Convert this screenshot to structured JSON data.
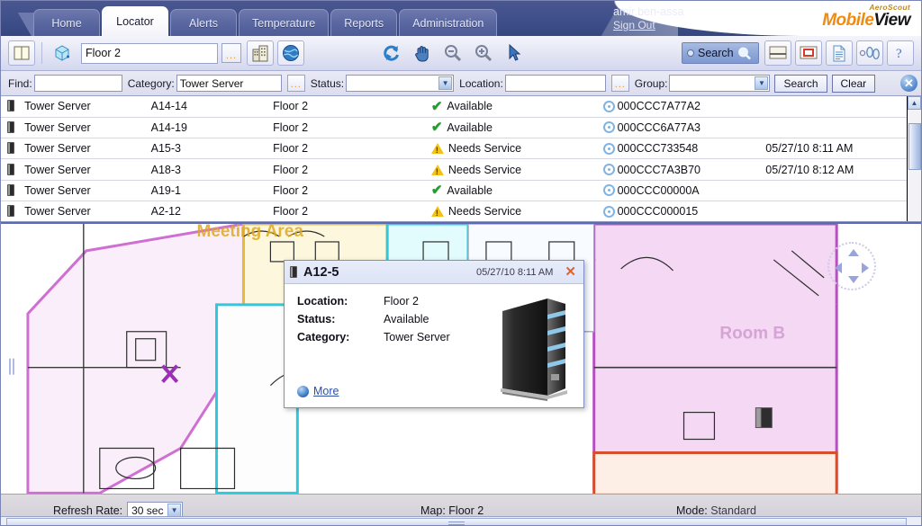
{
  "app": {
    "brand_top": "AeroScout",
    "brand_main_a": "Mobile",
    "brand_main_b": "View"
  },
  "header": {
    "tabs": [
      {
        "label": "Home",
        "active": false
      },
      {
        "label": "Locator",
        "active": true
      },
      {
        "label": "Alerts",
        "active": false
      },
      {
        "label": "Temperature",
        "active": false
      },
      {
        "label": "Reports",
        "active": false
      },
      {
        "label": "Administration",
        "active": false
      }
    ],
    "user": "amir.ben-assa",
    "sign_out": "Sign Out"
  },
  "toolbar": {
    "map_value": "Floor 2",
    "browse_dots": "...",
    "search_label": "Search",
    "icons": [
      "panel-toggle-icon",
      "add-zone-icon",
      "building-icon",
      "globe-icon",
      "refresh-icon",
      "pan-hand-icon",
      "zoom-out-icon",
      "zoom-in-icon",
      "select-arrow-icon",
      "split-view-icon",
      "highlight-box-icon",
      "report-page-icon",
      "footprints-icon",
      "help-icon"
    ]
  },
  "filterbar": {
    "find_label": "Find:",
    "find_value": "",
    "category_label": "Category:",
    "category_value": "Tower Server",
    "category_dots": "...",
    "status_label": "Status:",
    "status_value": "",
    "location_label": "Location:",
    "location_value": "",
    "location_dots": "...",
    "group_label": "Group:",
    "group_value": "",
    "search_button": "Search",
    "clear_button": "Clear"
  },
  "table": {
    "rows": [
      {
        "icon": "server-icon",
        "category": "Tower Server",
        "name": "A14-14",
        "location": "Floor 2",
        "status": "Available",
        "status_type": "ok",
        "tag": "000CCC7A77A2",
        "time": ""
      },
      {
        "icon": "server-icon",
        "category": "Tower Server",
        "name": "A14-19",
        "location": "Floor 2",
        "status": "Available",
        "status_type": "ok",
        "tag": "000CCC6A77A3",
        "time": ""
      },
      {
        "icon": "server-icon",
        "category": "Tower Server",
        "name": "A15-3",
        "location": "Floor 2",
        "status": "Needs Service",
        "status_type": "warn",
        "tag": "000CCC733548",
        "time": "05/27/10 8:11 AM"
      },
      {
        "icon": "server-icon",
        "category": "Tower Server",
        "name": "A18-3",
        "location": "Floor 2",
        "status": "Needs Service",
        "status_type": "warn",
        "tag": "000CCC7A3B70",
        "time": "05/27/10 8:12 AM"
      },
      {
        "icon": "server-icon",
        "category": "Tower Server",
        "name": "A19-1",
        "location": "Floor 2",
        "status": "Available",
        "status_type": "ok",
        "tag": "000CCC00000A",
        "time": ""
      },
      {
        "icon": "server-icon",
        "category": "Tower Server",
        "name": "A2-12",
        "location": "Floor 2",
        "status": "Needs Service",
        "status_type": "warn",
        "tag": "000CCC000015",
        "time": ""
      }
    ]
  },
  "map": {
    "zone_label": "Meeting Area",
    "marker_name": "A12-5"
  },
  "popup": {
    "title": "A12-5",
    "timestamp": "05/27/10 8:11 AM",
    "location_label": "Location:",
    "location_value": "Floor 2",
    "status_label": "Status:",
    "status_value": "Available",
    "category_label": "Category:",
    "category_value": "Tower Server",
    "more_label": "More",
    "close": "✕"
  },
  "statusbar": {
    "refresh_label": "Refresh Rate:",
    "refresh_value": "30 sec",
    "map_label": "Map:",
    "map_value": "Floor 2",
    "mode_label": "Mode:",
    "mode_value": "Standard"
  },
  "colors": {
    "header_blue": "#41518c",
    "accent_orange": "#ef8b12",
    "marker_orange": "#f59a12",
    "status_ok_green": "#1f9e2e",
    "status_warn_yellow": "#f2c21a",
    "zone_pink": "#f7dff7",
    "zone_cyan": "#5fd8e6",
    "zone_yellow": "#f3e89a"
  }
}
